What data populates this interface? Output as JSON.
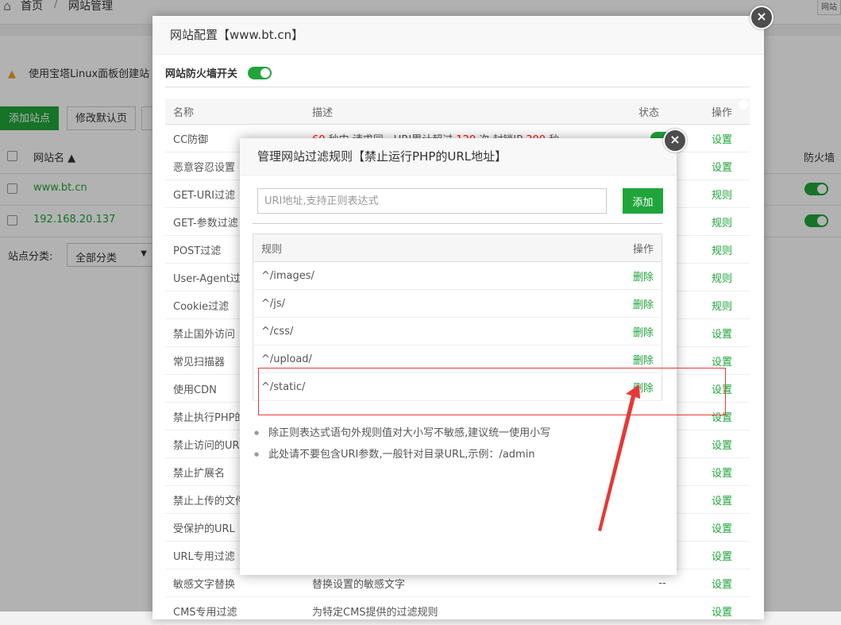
{
  "background": {
    "breadcrumb": {
      "home": "首页",
      "separator": "/",
      "current": "网站管理"
    },
    "corner_label": "网站",
    "warning": "使用宝塔Linux面板创建站",
    "buttons": {
      "add_site": "添加站点",
      "modify_default": "修改默认页"
    },
    "table": {
      "col_name": "网站名 ▲",
      "col_firewall": "防火墙",
      "rows": [
        {
          "name": "www.bt.cn"
        },
        {
          "name": "192.168.20.137"
        }
      ]
    },
    "category": {
      "label": "站点分类:",
      "value": "全部分类"
    }
  },
  "modal_site_config": {
    "title": "网站配置【www.bt.cn】",
    "firewall_switch_label": "网站防火墙开关",
    "table": {
      "headers": {
        "name": "名称",
        "desc": "描述",
        "status": "状态",
        "op": "操作"
      },
      "rows": [
        {
          "name": "CC防御",
          "desc_pre": "",
          "desc_num1": "60",
          "desc_mid1": " 秒内,请求同一URI累计超过 ",
          "desc_num2": "120",
          "desc_mid2": " 次,封锁IP ",
          "desc_num3": "300",
          "desc_post": " 秒",
          "status": "",
          "op": "设置"
        },
        {
          "name": "恶意容忍设置",
          "op": "设置"
        },
        {
          "name": "GET-URI过滤",
          "op": "规则"
        },
        {
          "name": "GET-参数过滤",
          "op": "规则"
        },
        {
          "name": "POST过滤",
          "op": "规则"
        },
        {
          "name": "User-Agent过滤",
          "op": "规则"
        },
        {
          "name": "Cookie过滤",
          "op": "规则"
        },
        {
          "name": "禁止国外访问",
          "op": "设置"
        },
        {
          "name": "常见扫描器",
          "op": "设置"
        },
        {
          "name": "使用CDN",
          "op": "设置"
        },
        {
          "name": "禁止执行PHP的URL",
          "op": "设置"
        },
        {
          "name": "禁止访问的URL",
          "op": "设置"
        },
        {
          "name": "禁止扩展名",
          "op": "设置"
        },
        {
          "name": "禁止上传的文件类型",
          "op": "设置"
        },
        {
          "name": "受保护的URL",
          "op": "设置"
        },
        {
          "name": "URL专用过滤",
          "op": "设置"
        },
        {
          "name": "敏感文字替换",
          "desc": "替换设置的敏感文字",
          "status": "--",
          "op": "设置"
        },
        {
          "name": "CMS专用过滤",
          "desc": "为特定CMS提供的过滤规则",
          "status": "",
          "op": "设置"
        }
      ]
    }
  },
  "modal_filter_rules": {
    "title": "管理网站过滤规则【禁止运行PHP的URL地址】",
    "input_placeholder": "URI地址,支持正则表达式",
    "add_label": "添加",
    "headers": {
      "rule": "规则",
      "op": "操作"
    },
    "rules": [
      {
        "rule": "^/images/",
        "op": "删除"
      },
      {
        "rule": "^/js/",
        "op": "删除"
      },
      {
        "rule": "^/css/",
        "op": "删除"
      },
      {
        "rule": "^/upload/",
        "op": "删除"
      },
      {
        "rule": "^/static/",
        "op": "删除"
      }
    ],
    "notes": [
      "除正则表达式语句外规则值对大小写不敏感,建议统一使用小写",
      "此处请不要包含URI参数,一般针对目录URL,示例：/admin"
    ]
  },
  "colors": {
    "accent": "#20a53a",
    "annotation": "#e53935",
    "warning": "#f0a020"
  }
}
